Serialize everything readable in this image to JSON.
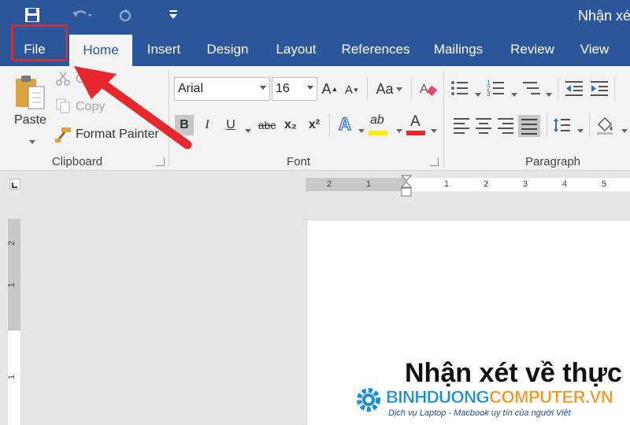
{
  "window": {
    "title": "Nhận xét"
  },
  "tabs": [
    "File",
    "Home",
    "Insert",
    "Design",
    "Layout",
    "References",
    "Mailings",
    "Review",
    "View"
  ],
  "clipboard": {
    "paste": "Paste",
    "cut": "Cut",
    "copy": "Copy",
    "format_painter": "Format Painter",
    "label": "Clipboard"
  },
  "font": {
    "name": "Arial",
    "size": "16",
    "case": "Aa",
    "bold": "B",
    "italic": "I",
    "underline": "U",
    "strike": "abc",
    "subscript": "x₂",
    "superscript": "x²",
    "effects": "A",
    "highlight": "ab",
    "color": "A",
    "grow": "A",
    "shrink": "A",
    "label": "Font"
  },
  "paragraph": {
    "label": "Paragraph"
  },
  "ruler": {
    "h_ticks": [
      "2",
      "1",
      "1",
      "2",
      "3",
      "4",
      "5"
    ],
    "v_ticks": [
      "2",
      "1",
      "1"
    ]
  },
  "document": {
    "heading": "Nhận xét về thực"
  },
  "watermark": {
    "brand_part1": "BINHDUONG",
    "brand_part2": "COMPUTER.VN",
    "tagline": "Dịch vụ Laptop - Macbook uy tín của người Việt"
  },
  "colors": {
    "word_blue": "#2b579a",
    "ribbon_bg": "#f3f3f3",
    "annotation_red": "#e8262d",
    "highlight_yellow": "#ffea00",
    "font_red": "#e8262d",
    "brand_blue": "#1a8fd6",
    "brand_orange": "#f5961d"
  }
}
